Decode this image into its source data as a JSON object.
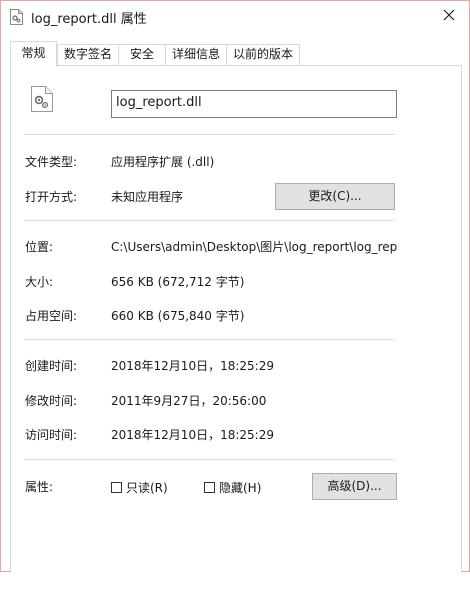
{
  "window": {
    "title": "log_report.dll 属性",
    "close_icon": "close-icon"
  },
  "tabs": [
    {
      "label": "常规",
      "active": true
    },
    {
      "label": "数字签名",
      "active": false
    },
    {
      "label": "安全",
      "active": false
    },
    {
      "label": "详细信息",
      "active": false
    },
    {
      "label": "以前的版本",
      "active": false
    }
  ],
  "general": {
    "file_icon": "dll-file-icon",
    "file_name": "log_report.dll",
    "type_label": "文件类型:",
    "type_value": "应用程序扩展 (.dll)",
    "opens_with_label": "打开方式:",
    "opens_with_value": "未知应用程序",
    "change_button": "更改(C)...",
    "location_label": "位置:",
    "location_value": "C:\\Users\\admin\\Desktop\\图片\\log_report\\log_rep",
    "size_label": "大小:",
    "size_value": "656 KB (672,712 字节)",
    "size_on_disk_label": "占用空间:",
    "size_on_disk_value": "660 KB (675,840 字节)",
    "created_label": "创建时间:",
    "created_value": "2018年12月10日，18:25:29",
    "modified_label": "修改时间:",
    "modified_value": "2011年9月27日，20:56:00",
    "accessed_label": "访问时间:",
    "accessed_value": "2018年12月10日，18:25:29",
    "attributes_label": "属性:",
    "readonly_label": "只读(R)",
    "hidden_label": "隐藏(H)",
    "advanced_button": "高级(D)..."
  }
}
